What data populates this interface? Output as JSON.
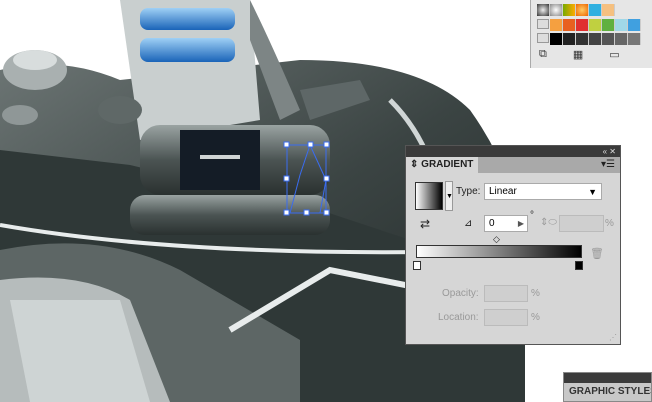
{
  "gradient_panel": {
    "title": "GRADIENT",
    "type_label": "Type:",
    "type_value": "Linear",
    "angle_value": "0",
    "angle_unit": "°",
    "aspect_unit": "%",
    "opacity_label": "Opacity:",
    "opacity_unit": "%",
    "location_label": "Location:",
    "location_unit": "%",
    "collapse_icon": "«",
    "close_icon": "✕"
  },
  "graphic_styles_panel": {
    "title": "GRAPHIC STYLES"
  },
  "swatches": {
    "row1": [
      "#444",
      "#888",
      "#e8c040",
      "#f0a030",
      "#30b0e0",
      "#f5c080"
    ],
    "row2": [
      "#f5a040",
      "#e86020",
      "#e03030",
      "#c0d040",
      "#60b040",
      "#a0d8e8",
      "#40a0e0"
    ],
    "row3": [
      "#000",
      "#222",
      "#333",
      "#444",
      "#555",
      "#666",
      "#777"
    ]
  }
}
